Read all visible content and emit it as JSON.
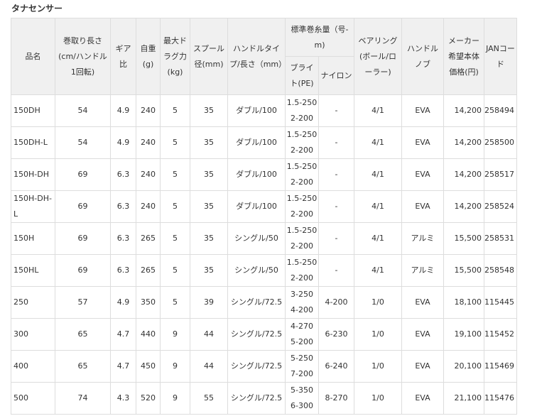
{
  "title": "タナセンサー",
  "headers": {
    "name": "品名",
    "winding_length": "巻取り長さ(cm/ハンドル1回転)",
    "gear_ratio": "ギア比",
    "weight": "自重(g)",
    "max_drag": "最大ドラグ力(kg)",
    "spool_diameter": "スプール径(mm)",
    "handle": "ハンドルタイプ/長さ（mm）",
    "line_capacity": "標準巻糸量（号-m)",
    "braid": "ブライト(PE)",
    "nylon": "ナイロン",
    "bearing": "ベアリング(ボール/ローラー)",
    "knob": "ハンドルノブ",
    "price": "メーカー希望本体価格(円)",
    "jan": "JANコード"
  },
  "rows": [
    {
      "name": "150DH",
      "winding": "54",
      "gear": "4.9",
      "weight": "240",
      "drag": "5",
      "spool": "35",
      "handle": "ダブル/100",
      "braid_1": "1.5-250",
      "braid_2": "2-200",
      "nylon": "-",
      "bearing": "4/1",
      "knob": "EVA",
      "price": "14,200",
      "jan": "258494"
    },
    {
      "name": "150DH-L",
      "winding": "54",
      "gear": "4.9",
      "weight": "240",
      "drag": "5",
      "spool": "35",
      "handle": "ダブル/100",
      "braid_1": "1.5-250",
      "braid_2": "2-200",
      "nylon": "-",
      "bearing": "4/1",
      "knob": "EVA",
      "price": "14,200",
      "jan": "258500"
    },
    {
      "name": "150H-DH",
      "winding": "69",
      "gear": "6.3",
      "weight": "240",
      "drag": "5",
      "spool": "35",
      "handle": "ダブル/100",
      "braid_1": "1.5-250",
      "braid_2": "2-200",
      "nylon": "-",
      "bearing": "4/1",
      "knob": "EVA",
      "price": "14,200",
      "jan": "258517"
    },
    {
      "name": "150H-DH-L",
      "winding": "69",
      "gear": "6.3",
      "weight": "240",
      "drag": "5",
      "spool": "35",
      "handle": "ダブル/100",
      "braid_1": "1.5-250",
      "braid_2": "2-200",
      "nylon": "-",
      "bearing": "4/1",
      "knob": "EVA",
      "price": "14,200",
      "jan": "258524"
    },
    {
      "name": "150H",
      "winding": "69",
      "gear": "6.3",
      "weight": "265",
      "drag": "5",
      "spool": "35",
      "handle": "シングル/50",
      "braid_1": "1.5-250",
      "braid_2": "2-200",
      "nylon": "-",
      "bearing": "4/1",
      "knob": "アルミ",
      "price": "15,500",
      "jan": "258531"
    },
    {
      "name": "150HL",
      "winding": "69",
      "gear": "6.3",
      "weight": "265",
      "drag": "5",
      "spool": "35",
      "handle": "シングル/50",
      "braid_1": "1.5-250",
      "braid_2": "2-200",
      "nylon": "-",
      "bearing": "4/1",
      "knob": "アルミ",
      "price": "15,500",
      "jan": "258548"
    },
    {
      "name": "250",
      "winding": "57",
      "gear": "4.9",
      "weight": "350",
      "drag": "5",
      "spool": "39",
      "handle": "シングル/72.5",
      "braid_1": "3-250",
      "braid_2": "4-200",
      "nylon": "4-200",
      "bearing": "1/0",
      "knob": "EVA",
      "price": "18,100",
      "jan": "115445"
    },
    {
      "name": "300",
      "winding": "65",
      "gear": "4.7",
      "weight": "440",
      "drag": "9",
      "spool": "44",
      "handle": "シングル/72.5",
      "braid_1": "4-270",
      "braid_2": "5-200",
      "nylon": "6-230",
      "bearing": "1/0",
      "knob": "EVA",
      "price": "19,100",
      "jan": "115452"
    },
    {
      "name": "400",
      "winding": "65",
      "gear": "4.7",
      "weight": "450",
      "drag": "9",
      "spool": "44",
      "handle": "シングル/72.5",
      "braid_1": "5-250",
      "braid_2": "7-200",
      "nylon": "6-240",
      "bearing": "1/0",
      "knob": "EVA",
      "price": "20,100",
      "jan": "115469"
    },
    {
      "name": "500",
      "winding": "74",
      "gear": "4.3",
      "weight": "520",
      "drag": "9",
      "spool": "55",
      "handle": "シングル/72.5",
      "braid_1": "5-350",
      "braid_2": "6-300",
      "nylon": "8-270",
      "bearing": "1/0",
      "knob": "EVA",
      "price": "21,100",
      "jan": "115476"
    }
  ]
}
